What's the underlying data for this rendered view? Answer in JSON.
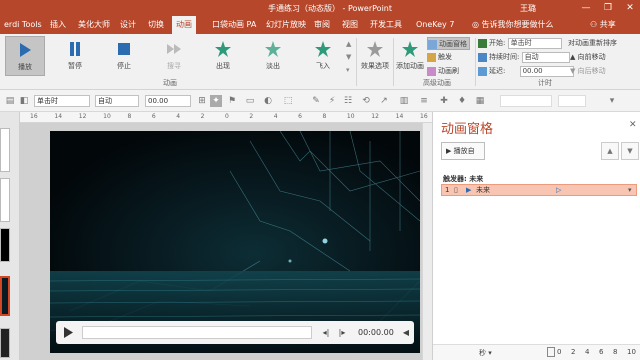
{
  "window": {
    "title": "手通练习（动态版） - PowerPoint",
    "user": "王璐",
    "controls": [
      "—",
      "❐",
      "✕"
    ]
  },
  "tabs": [
    {
      "label": "erdi Tools",
      "active": false
    },
    {
      "label": "插入",
      "active": false
    },
    {
      "label": "美化大师",
      "active": false
    },
    {
      "label": "设计",
      "active": false
    },
    {
      "label": "切换",
      "active": false
    },
    {
      "label": "动画",
      "active": true
    },
    {
      "label": "口袋动画 PA",
      "active": false
    },
    {
      "label": "幻灯片放映",
      "active": false
    },
    {
      "label": "审阅",
      "active": false
    },
    {
      "label": "视图",
      "active": false
    },
    {
      "label": "开发工具",
      "active": false
    },
    {
      "label": "OneKey 7",
      "active": false
    }
  ],
  "tellme": "告诉我你想要做什么",
  "share": "共享",
  "ribbon": {
    "media_buttons": [
      {
        "label": "播放",
        "icon": "play-icon",
        "selected": true
      },
      {
        "label": "暂停",
        "icon": "pause-icon",
        "selected": false
      },
      {
        "label": "停止",
        "icon": "stop-icon",
        "selected": false
      },
      {
        "label": "搜寻",
        "icon": "seek-icon",
        "selected": false
      }
    ],
    "effects": [
      {
        "label": "出现",
        "icon": "appear-star-icon"
      },
      {
        "label": "淡出",
        "icon": "fade-star-icon"
      },
      {
        "label": "飞入",
        "icon": "fly-in-star-icon"
      }
    ],
    "effect_options": "效果选项",
    "add_animation": "添加动画",
    "animation_group": "动画",
    "advanced": {
      "pane": "动画窗格",
      "trigger": "触发",
      "painter": "动画刷",
      "label": "高级动画"
    },
    "timing": {
      "start_label": "开始:",
      "start_value": "单击时",
      "duration_label": "持续时间:",
      "duration_value": "自动",
      "delay_label": "延迟:",
      "delay_value": "00.00",
      "reorder": "对动画重新排序",
      "move_earlier": "向前移动",
      "move_later": "向后移动",
      "label": "计时"
    }
  },
  "toolbar": {
    "start": "单击时",
    "duration": "自动",
    "delay": "00.00"
  },
  "ruler": {
    "labels": [
      "16",
      "14",
      "12",
      "10",
      "8",
      "6",
      "4",
      "2",
      "0",
      "2",
      "4",
      "6",
      "8",
      "10",
      "12",
      "14",
      "16"
    ]
  },
  "media": {
    "time": "00:00.00"
  },
  "animpane": {
    "title": "动画窗格",
    "play_from": "播放自",
    "trigger_label": "触发器: 未来",
    "item": {
      "index": "1",
      "name": "未来"
    },
    "footer_label": "秒",
    "ticks": [
      "0",
      "2",
      "4",
      "6",
      "8",
      "10"
    ]
  },
  "colors": {
    "accent": "#b7472a",
    "selected_row": "#f8c5b2"
  }
}
